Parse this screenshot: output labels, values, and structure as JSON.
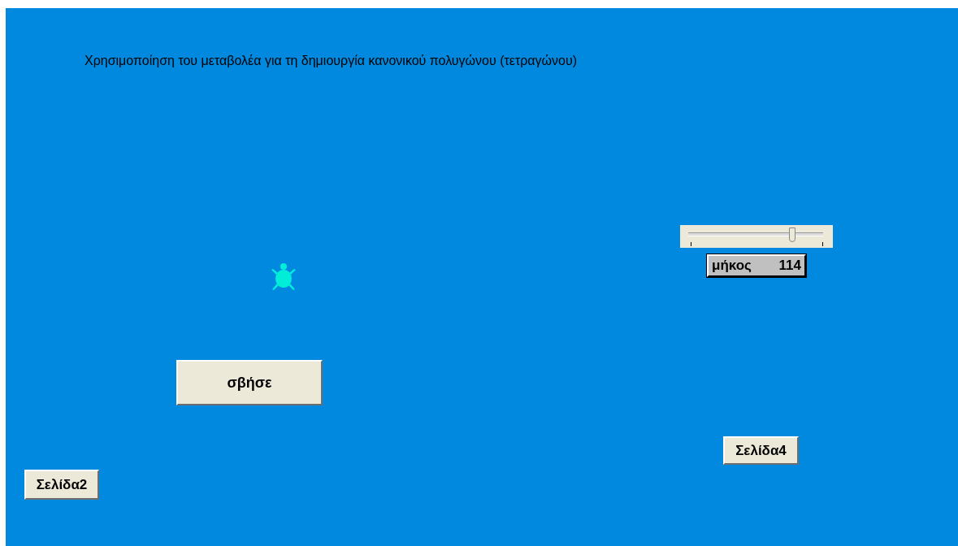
{
  "title": "Χρησιμοποίηση του μεταβολέα για τη δημιουργία κανονικού πολυγώνου (τετραγώνου)",
  "slider": {
    "level": 0.77,
    "label": "μήκος",
    "value": "114"
  },
  "buttons": [
    {
      "label": "σβήσε",
      "kind": "large"
    },
    {
      "label": "Σελίδα4",
      "kind": "small"
    },
    {
      "label": "Σελίδα2",
      "kind": "small"
    }
  ]
}
